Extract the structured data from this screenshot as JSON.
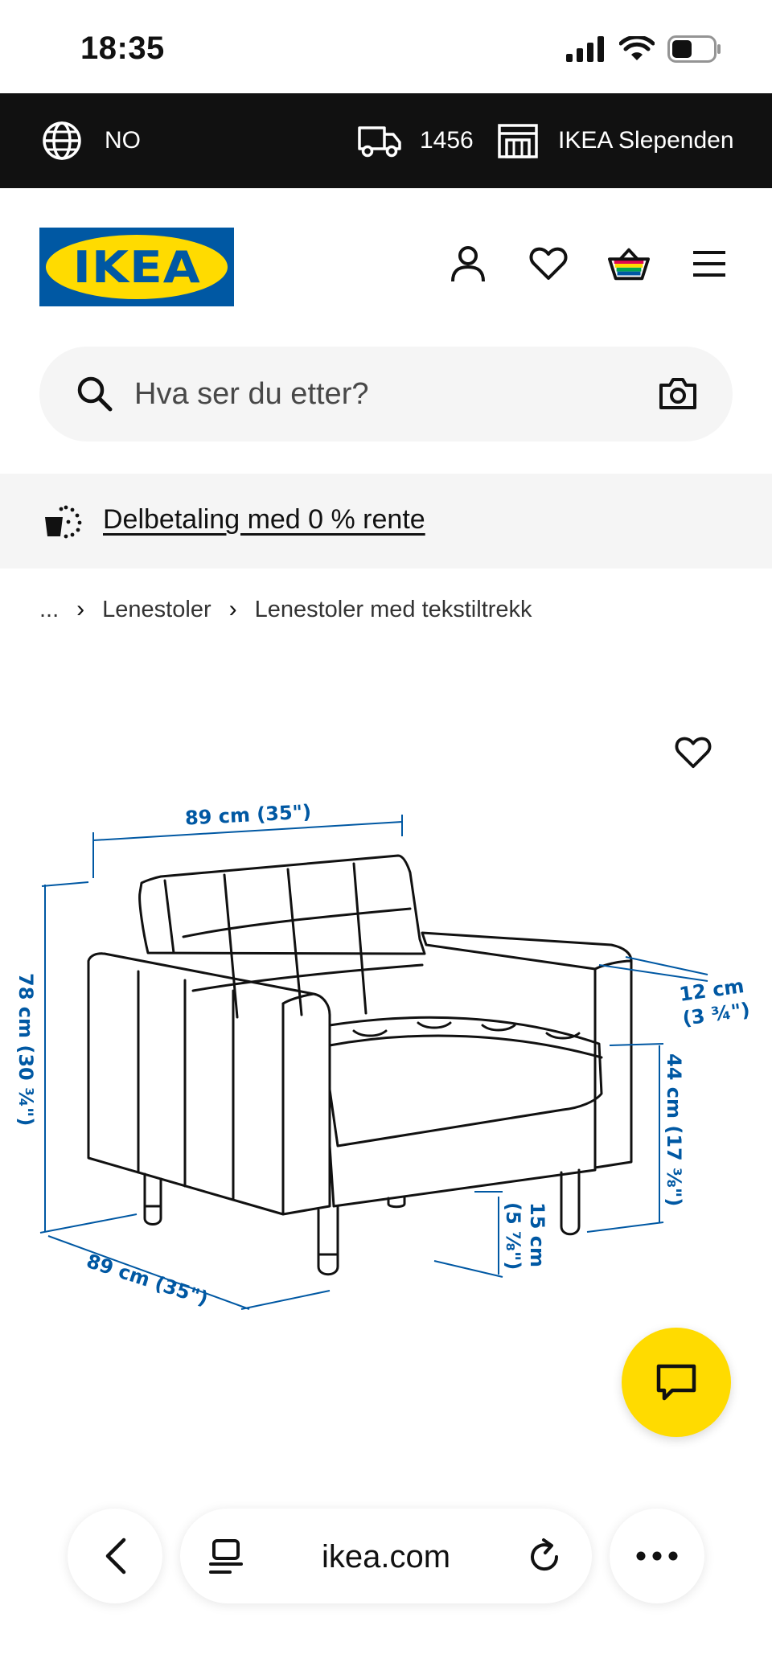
{
  "status_bar": {
    "time": "18:35",
    "icons": [
      "cellular-signal-icon",
      "wifi-icon",
      "battery-icon"
    ]
  },
  "topbar": {
    "language": "NO",
    "language_icon": "globe-icon",
    "postal_code": "1456",
    "postal_icon": "delivery-truck-icon",
    "store": "IKEA Slependen",
    "store_icon": "store-icon"
  },
  "header": {
    "logo_text": "IKEA",
    "icons": [
      "account-icon",
      "favorites-heart-icon",
      "shopping-basket-icon",
      "menu-icon"
    ]
  },
  "search": {
    "placeholder": "Hva ser du etter?",
    "icon": "search-icon",
    "camera_icon": "camera-icon"
  },
  "promo": {
    "icon": "installment-payment-icon",
    "link_text": "Delbetaling med 0 % rente"
  },
  "breadcrumb": {
    "ellipsis": "...",
    "items": [
      "Lenestoler",
      "Lenestoler med tekstiltrekk"
    ]
  },
  "product_image": {
    "alt": "Armchair dimension drawing",
    "dimensions": {
      "width_top": "89 cm (35\")",
      "height": "78 cm (30 ¾\")",
      "depth": "89 cm (35\")",
      "arm_width_cm": "12 cm",
      "arm_width_in": "(3 ¾\")",
      "seat_height": "44 cm (17 ⅜\")",
      "leg_height_cm": "15 cm",
      "leg_height_in": "(5 ⅞\")"
    },
    "dimension_color": "#0058a3",
    "favorite_icon": "heart-icon"
  },
  "chat": {
    "icon": "chat-bubble-icon",
    "color": "#ffdb00"
  },
  "browser": {
    "url": "ikea.com",
    "back_icon": "chevron-left-icon",
    "reader_icon": "reader-mode-icon",
    "reload_icon": "reload-icon",
    "more_icon": "more-dots-icon"
  }
}
